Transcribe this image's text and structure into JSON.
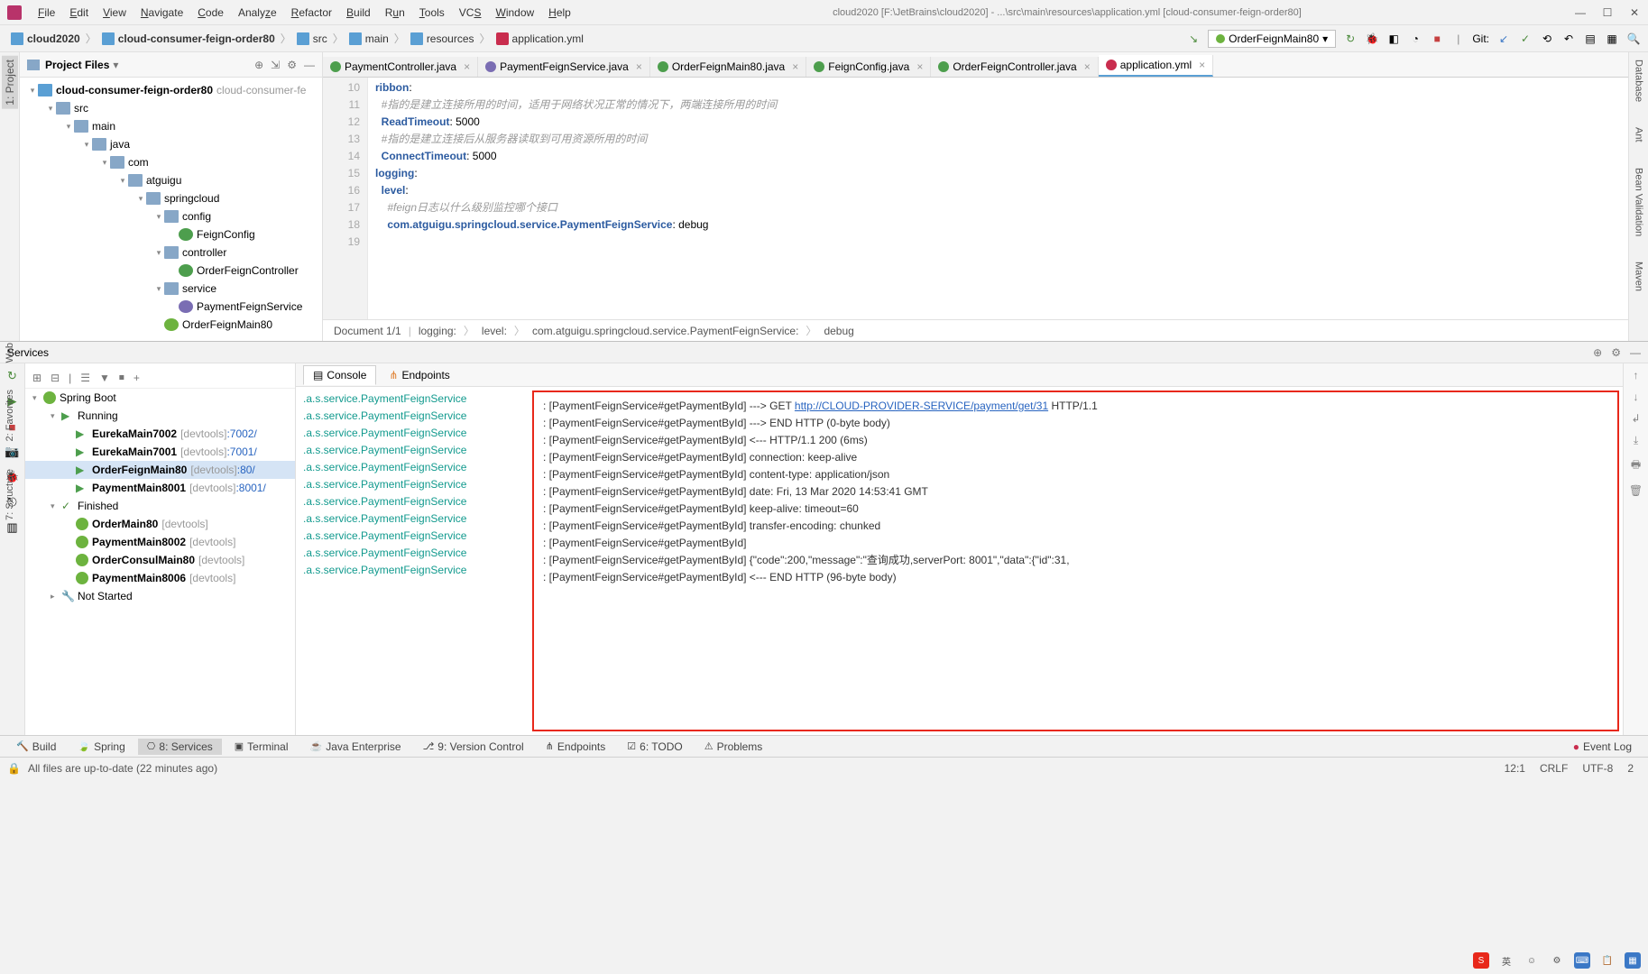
{
  "window": {
    "title": "cloud2020 [F:\\JetBrains\\cloud2020] - ...\\src\\main\\resources\\application.yml [cloud-consumer-feign-order80]"
  },
  "menu": [
    "File",
    "Edit",
    "View",
    "Navigate",
    "Code",
    "Analyze",
    "Refactor",
    "Build",
    "Run",
    "Tools",
    "VCS",
    "Window",
    "Help"
  ],
  "breadcrumbs": [
    "cloud2020",
    "cloud-consumer-feign-order80",
    "src",
    "main",
    "resources",
    "application.yml"
  ],
  "run_config": "OrderFeignMain80",
  "git_label": "Git:",
  "project_panel": {
    "title": "Project Files",
    "tree": {
      "root": "cloud-consumer-feign-order80",
      "root_hint": "cloud-consumer-fe",
      "src": "src",
      "main": "main",
      "java": "java",
      "com": "com",
      "atguigu": "atguigu",
      "springcloud": "springcloud",
      "config": "config",
      "feignconfig": "FeignConfig",
      "controller": "controller",
      "orderfeignctrl": "OrderFeignController",
      "service": "service",
      "paymentfeignsvc": "PaymentFeignService",
      "orderfeignmain": "OrderFeignMain80"
    }
  },
  "editor_tabs": [
    {
      "name": "PaymentController.java",
      "iconClass": "fi-c"
    },
    {
      "name": "PaymentFeignService.java",
      "iconClass": "fi-i"
    },
    {
      "name": "OrderFeignMain80.java",
      "iconClass": "fi-c"
    },
    {
      "name": "FeignConfig.java",
      "iconClass": "fi-c"
    },
    {
      "name": "OrderFeignController.java",
      "iconClass": "fi-c"
    },
    {
      "name": "application.yml",
      "iconClass": "fi-y",
      "active": true
    }
  ],
  "editor": {
    "line_start": 10,
    "lines": [
      {
        "n": 10,
        "t": "ribbon:",
        "cls": "key"
      },
      {
        "n": 11,
        "t": "  #指的是建立连接所用的时间，适用于网络状况正常的情况下，两端连接所用的时间",
        "cls": "comment"
      },
      {
        "n": 12,
        "t": "  ReadTimeout: 5000",
        "cls": "key"
      },
      {
        "n": 13,
        "t": "  #指的是建立连接后从服务器读取到可用资源所用的时间",
        "cls": "comment"
      },
      {
        "n": 14,
        "t": "  ConnectTimeout: 5000",
        "cls": "key"
      },
      {
        "n": 15,
        "t": "",
        "cls": ""
      },
      {
        "n": 16,
        "t": "logging:",
        "cls": "key"
      },
      {
        "n": 17,
        "t": "  level:",
        "cls": "key"
      },
      {
        "n": 18,
        "t": "    #feign日志以什么级别监控哪个接口",
        "cls": "comment"
      },
      {
        "n": 19,
        "t": "    com.atguigu.springcloud.service.PaymentFeignService: debug",
        "cls": "key"
      }
    ]
  },
  "editor_crumb": {
    "doc": "Document 1/1",
    "path": [
      "logging:",
      "level:",
      "com.atguigu.springcloud.service.PaymentFeignService:",
      "debug"
    ]
  },
  "services": {
    "title": "Services",
    "tree": {
      "root": "Spring Boot",
      "running": "Running",
      "finished": "Finished",
      "notstarted": "Not Started",
      "items_running": [
        {
          "name": "EurekaMain7002",
          "hint": "[devtools]",
          "port": ":7002/"
        },
        {
          "name": "EurekaMain7001",
          "hint": "[devtools]",
          "port": ":7001/"
        },
        {
          "name": "OrderFeignMain80",
          "hint": "[devtools]",
          "port": ":80/",
          "selected": true
        },
        {
          "name": "PaymentMain8001",
          "hint": "[devtools]",
          "port": ":8001/"
        }
      ],
      "items_finished": [
        {
          "name": "OrderMain80",
          "hint": "[devtools]"
        },
        {
          "name": "PaymentMain8002",
          "hint": "[devtools]"
        },
        {
          "name": "OrderConsulMain80",
          "hint": "[devtools]"
        },
        {
          "name": "PaymentMain8006",
          "hint": "[devtools]"
        }
      ]
    },
    "console_tabs": {
      "console": "Console",
      "endpoints": "Endpoints"
    },
    "logger_lines_count": 11,
    "logger_prefix": ".a.s.service.PaymentFeignService",
    "log_url": "http://CLOUD-PROVIDER-SERVICE/payment/get/31",
    "log_lines": [
      ": [PaymentFeignService#getPaymentById] ---> GET ",
      ": [PaymentFeignService#getPaymentById] ---> END HTTP (0-byte body)",
      ": [PaymentFeignService#getPaymentById] <--- HTTP/1.1 200 (6ms)",
      ": [PaymentFeignService#getPaymentById] connection: keep-alive",
      ": [PaymentFeignService#getPaymentById] content-type: application/json",
      ": [PaymentFeignService#getPaymentById] date: Fri, 13 Mar 2020 14:53:41 GMT",
      ": [PaymentFeignService#getPaymentById] keep-alive: timeout=60",
      ": [PaymentFeignService#getPaymentById] transfer-encoding: chunked",
      ": [PaymentFeignService#getPaymentById] ",
      ": [PaymentFeignService#getPaymentById] {\"code\":200,\"message\":\"查询成功,serverPort: 8001\",\"data\":{\"id\":31,",
      ": [PaymentFeignService#getPaymentById] <--- END HTTP (96-byte body)"
    ],
    "log_http_suffix": " HTTP/1.1"
  },
  "bottom_tabs": {
    "build": "Build",
    "spring": "Spring",
    "services": "8: Services",
    "terminal": "Terminal",
    "javaee": "Java Enterprise",
    "vcs": "9: Version Control",
    "endpoints": "Endpoints",
    "todo": "6: TODO",
    "problems": "Problems",
    "eventlog": "Event Log"
  },
  "status": {
    "msg": "All files are up-to-date (22 minutes ago)",
    "pos": "12:1",
    "sep": "CRLF",
    "enc": "UTF-8",
    "spaces": "2"
  },
  "side_tabs": {
    "left_project": "1: Project",
    "left_web": "Web",
    "left_fav": "2: Favorites",
    "left_struct": "7: Structure",
    "right_db": "Database",
    "right_ant": "Ant",
    "right_bean": "Bean Validation",
    "right_maven": "Maven"
  }
}
